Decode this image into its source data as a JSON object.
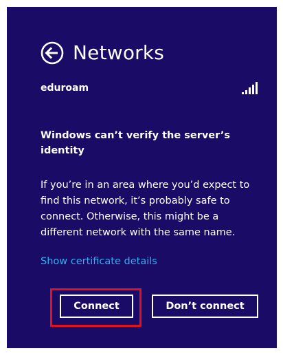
{
  "header": {
    "title": "Networks",
    "back_icon": "back-arrow-circle-icon"
  },
  "network": {
    "name": "eduroam",
    "signal_icon": "wifi-signal-bars-icon",
    "signal_bars": 5
  },
  "warning": {
    "title": "Windows can’t verify the server’s identity",
    "body": "If you’re in an area where you’d expect to find this network, it’s probably safe to connect. Otherwise, this might be a different network with the same name."
  },
  "links": {
    "certificate": "Show certificate details"
  },
  "buttons": {
    "connect": "Connect",
    "dont_connect": "Don’t connect"
  },
  "colors": {
    "panel_background": "#1a0b66",
    "link": "#2eb1f2",
    "highlight": "#e0121e",
    "text": "#ffffff"
  }
}
